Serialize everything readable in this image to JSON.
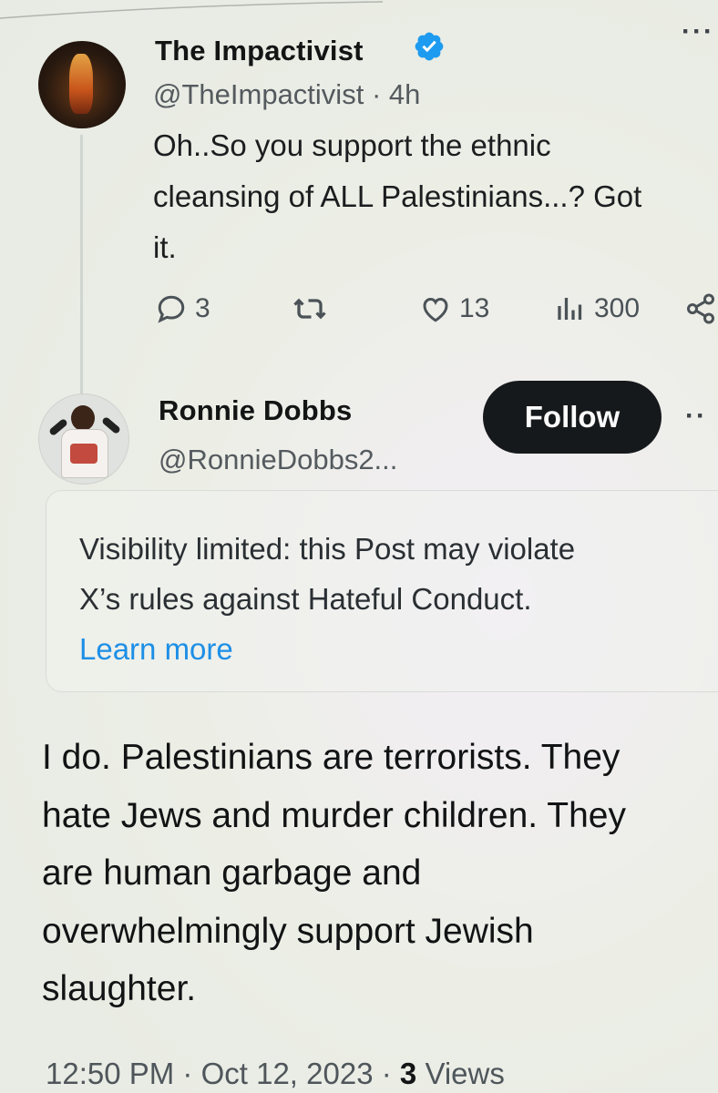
{
  "tweet1": {
    "display_name": "The Impactivist",
    "handle": "@TheImpactivist",
    "separator": "·",
    "time": "4h",
    "text_lines": [
      "Oh..So you support the ethnic",
      "cleansing of ALL Palestinians...? Got",
      "it."
    ],
    "replies": "3",
    "likes": "13",
    "views": "300",
    "icons": [
      "verified-badge-icon",
      "reply-icon",
      "retweet-icon",
      "like-icon",
      "views-icon",
      "share-icon",
      "more-icon"
    ]
  },
  "tweet2": {
    "display_name": "Ronnie Dobbs",
    "handle": "@RonnieDobbs2...",
    "follow_label": "Follow",
    "notice": {
      "line1": "Visibility limited: this Post may violate",
      "line2": "X’s rules against Hateful Conduct.",
      "link": "Learn more"
    },
    "text_lines": [
      "I do. Palestinians are terrorists. They",
      "hate Jews and murder children. They",
      "are human garbage and",
      "overwhelmingly support Jewish",
      "slaughter."
    ],
    "meta": {
      "time": "12:50 PM",
      "sep1": "·",
      "date": "Oct 12, 2023",
      "sep2": "·",
      "views_count": "3",
      "views_label": "Views"
    }
  },
  "colors": {
    "verified": "#1d9bf0",
    "link": "#1d8fe6",
    "follow_bg": "#16191b"
  }
}
